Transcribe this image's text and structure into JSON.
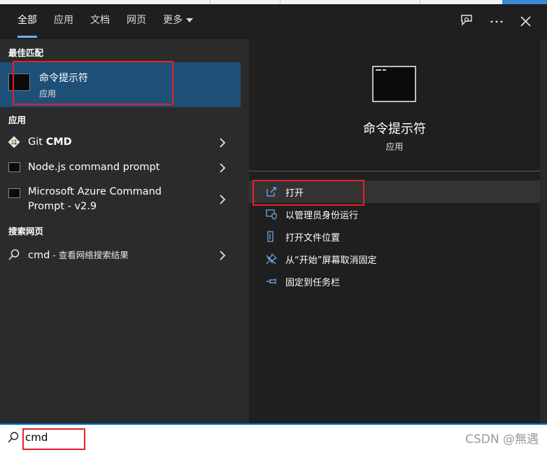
{
  "tabs": [
    "全部",
    "应用",
    "文档",
    "网页",
    "更多"
  ],
  "header_icons": [
    "feedback-icon",
    "more-icon",
    "close-icon"
  ],
  "left": {
    "best_match_heading": "最佳匹配",
    "best_match": {
      "name": "命令提示符",
      "type": "应用"
    },
    "apps_heading": "应用",
    "apps": [
      {
        "pre": "Git ",
        "bold": "CMD",
        "icon": "git-icon"
      },
      {
        "pre": "Node.js command prompt",
        "bold": "",
        "icon": "terminal-icon"
      },
      {
        "pre": "Microsoft Azure Command",
        "line2": "Prompt - v2.9",
        "bold": "",
        "icon": "terminal-icon"
      }
    ],
    "web_heading": "搜索网页",
    "web": {
      "query": "cmd",
      "suffix": " - 查看网络搜索结果"
    }
  },
  "right": {
    "name": "命令提示符",
    "type": "应用",
    "actions": [
      {
        "label": "打开",
        "icon": "open-icon"
      },
      {
        "label": "以管理员身份运行",
        "icon": "shield-icon"
      },
      {
        "label": "打开文件位置",
        "icon": "file-location-icon"
      },
      {
        "label": "从“开始”屏幕取消固定",
        "icon": "unpin-icon"
      },
      {
        "label": "固定到任务栏",
        "icon": "pin-icon"
      }
    ]
  },
  "search": {
    "value": "cmd"
  },
  "watermark": "CSDN @無遇",
  "colors": {
    "accent": "#0078d7",
    "selection": "#1e4f77",
    "highlight_box": "#e8202a"
  }
}
